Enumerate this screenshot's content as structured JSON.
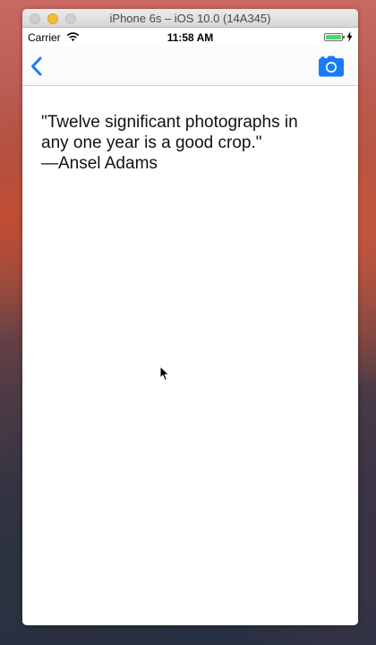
{
  "window": {
    "title": "iPhone 6s – iOS 10.0 (14A345)"
  },
  "status_bar": {
    "carrier": "Carrier",
    "time": "11:58 AM",
    "battery_level": 1.0,
    "icons": [
      "wifi-icon",
      "battery-icon",
      "charging-bolt-icon"
    ]
  },
  "nav_bar": {
    "left_icon": "chevron-left-icon",
    "right_icon": "camera-icon"
  },
  "quote": {
    "line1": "\"Twelve significant photographs in",
    "line2": "any one year is a good crop.\"",
    "line3": "—Ansel Adams"
  },
  "colors": {
    "tint": "#1a7cf5",
    "battery": "#4cd964",
    "traffic_minimize": "#f7bd35"
  }
}
